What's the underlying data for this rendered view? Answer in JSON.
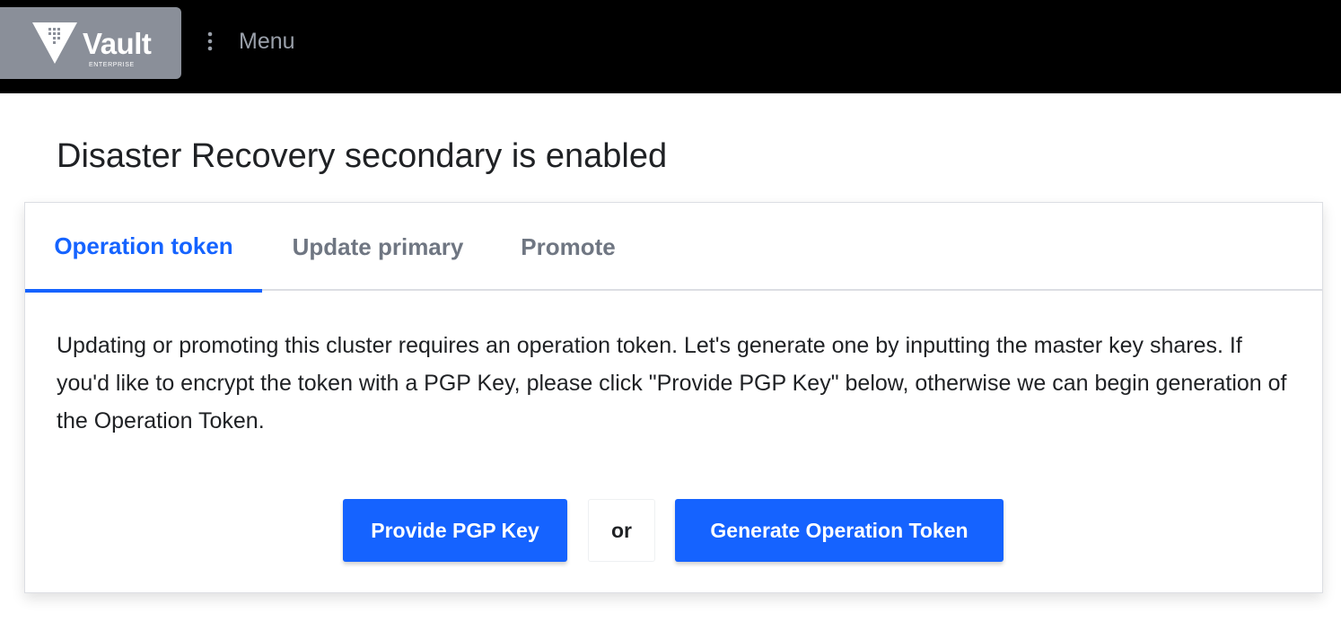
{
  "header": {
    "logo_text": "Vault",
    "logo_subtext": "ENTERPRISE",
    "logo_icon": "vault-triangle-icon",
    "menu_label": "Menu",
    "menu_icon": "vertical-dots-icon",
    "colors": {
      "bar": "#000000",
      "logo_bg": "#8a8f99",
      "menu_text": "#9aa0aa"
    }
  },
  "page": {
    "title": "Disaster Recovery secondary is enabled"
  },
  "tabs": [
    {
      "label": "Operation token",
      "active": true
    },
    {
      "label": "Update primary",
      "active": false
    },
    {
      "label": "Promote",
      "active": false
    }
  ],
  "content": {
    "description": "Updating or promoting this cluster requires an operation token. Let's generate one by inputting the master key shares. If you'd like to encrypt the token with a PGP Key, please click \"Provide PGP Key\" below, otherwise we can begin generation of the Operation Token.",
    "provide_pgp_label": "Provide PGP Key",
    "separator_label": "or",
    "generate_label": "Generate Operation Token"
  },
  "colors": {
    "accent": "#1563ff",
    "tab_inactive": "#6f7682",
    "text": "#1f2124"
  }
}
